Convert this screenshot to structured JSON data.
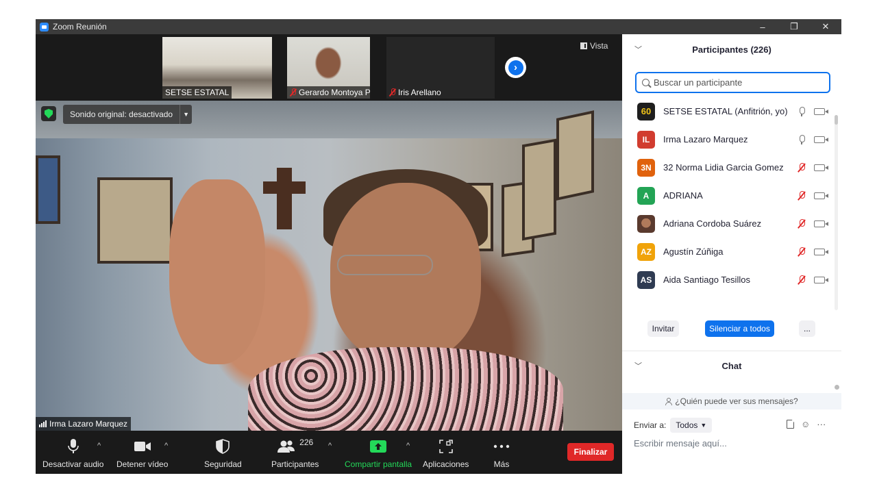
{
  "window": {
    "title": "Zoom Reunión",
    "controls": [
      "–",
      "❐",
      "✕"
    ]
  },
  "strip": {
    "thumbnails": [
      {
        "name": "SETSE ESTATAL",
        "muted": false
      },
      {
        "name": "Gerardo Montoya Pal...",
        "muted": true
      },
      {
        "name": "Iris Arellano",
        "muted": true
      }
    ],
    "next_icon": "chevron-right-icon",
    "view_label": "Vista"
  },
  "main_video": {
    "sound_label": "Sonido original: desactivado",
    "speaker_name": "Irma Lazaro Marquez"
  },
  "toolbar": {
    "mute": "Desactivar audio",
    "video": "Detener vídeo",
    "security": "Seguridad",
    "participants": "Participantes",
    "participants_count": "226",
    "share": "Compartir pantalla",
    "apps": "Aplicaciones",
    "more": "Más",
    "end": "Finalizar",
    "end_color": "#e02828",
    "share_color": "#23d959"
  },
  "panel": {
    "title": "Participantes (226)",
    "search_placeholder": "Buscar un participante",
    "participants": [
      {
        "initials": "60",
        "name": "SETSE ESTATAL (Anfitrión, yo)",
        "color": "#1e1e1e",
        "mic": "on"
      },
      {
        "initials": "IL",
        "name": "Irma Lazaro Marquez",
        "color": "#d13c2f",
        "mic": "on"
      },
      {
        "initials": "3N",
        "name": "32 Norma Lidia Garcia Gomez",
        "color": "#e0620d",
        "mic": "off"
      },
      {
        "initials": "A",
        "name": "ADRIANA",
        "color": "#23a455",
        "mic": "off"
      },
      {
        "initials": "",
        "name": "Adriana Cordoba Suárez",
        "color": "#8a5a4a",
        "mic": "off"
      },
      {
        "initials": "AZ",
        "name": "Agustín Zúñiga",
        "color": "#f0a30a",
        "mic": "off"
      },
      {
        "initials": "AS",
        "name": "Aida Santiago Tesillos",
        "color": "#2f3b52",
        "mic": "off"
      }
    ],
    "invite": "Invitar",
    "mute_all": "Silenciar a todos",
    "more": "...",
    "chat_title": "Chat",
    "who_can_see": "¿Quién puede ver sus mensajes?",
    "send_to_label": "Enviar a:",
    "send_to_value": "Todos",
    "message_placeholder": "Escribir mensaje aquí...",
    "accent": "#0e72ed"
  }
}
